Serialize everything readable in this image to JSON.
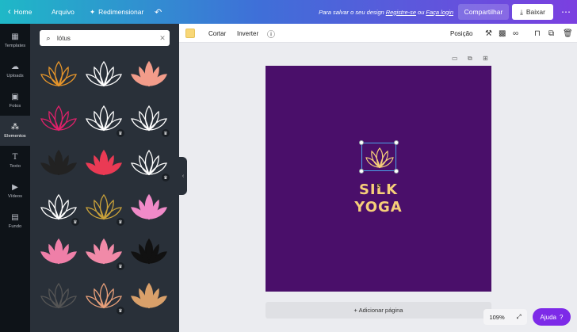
{
  "topbar": {
    "home_label": "Home",
    "file_label": "Arquivo",
    "resize_label": "Redimensionar",
    "save_text": "Para salvar o seu design",
    "signup_link": "Registre-se",
    "or_text": "ou",
    "login_link": "Faça login",
    "share_label": "Compartilhar",
    "download_label": "Baixar",
    "more_icon": "more-dots"
  },
  "leftnav": {
    "items": [
      {
        "label": "Templates",
        "icon": "templates"
      },
      {
        "label": "Uploads",
        "icon": "upload"
      },
      {
        "label": "Fotos",
        "icon": "photo"
      },
      {
        "label": "Elementos",
        "icon": "elements"
      },
      {
        "label": "Texto",
        "icon": "text"
      },
      {
        "label": "Vídeos",
        "icon": "video"
      },
      {
        "label": "Fundo",
        "icon": "background"
      }
    ],
    "active": "Elementos"
  },
  "panel": {
    "search_value": "lótus",
    "result_colors": [
      "#e8962a",
      "#ffffff",
      "#f29c8a",
      "#e0206a",
      "#ffffff",
      "#ffffff",
      "#222222",
      "#ea3a54",
      "#ffffff",
      "#ffffff",
      "#caa23a",
      "#f08ac8",
      "#ef7fa8",
      "#f18aa8",
      "#111111",
      "#555555",
      "#e9a07a",
      "#d9a06a"
    ]
  },
  "toolbar2": {
    "swatch_color": "#f8d777",
    "crop_label": "Cortar",
    "flip_label": "Inverter",
    "position_label": "Posição"
  },
  "canvas": {
    "background": "#4a0f6a",
    "line1": "SILK",
    "line2": "YOGA",
    "text_color": "#f6cf79"
  },
  "footer": {
    "add_page_label": "+ Adicionar página",
    "zoom_value": "109%",
    "help_label": "Ajuda",
    "help_icon_char": "?"
  }
}
